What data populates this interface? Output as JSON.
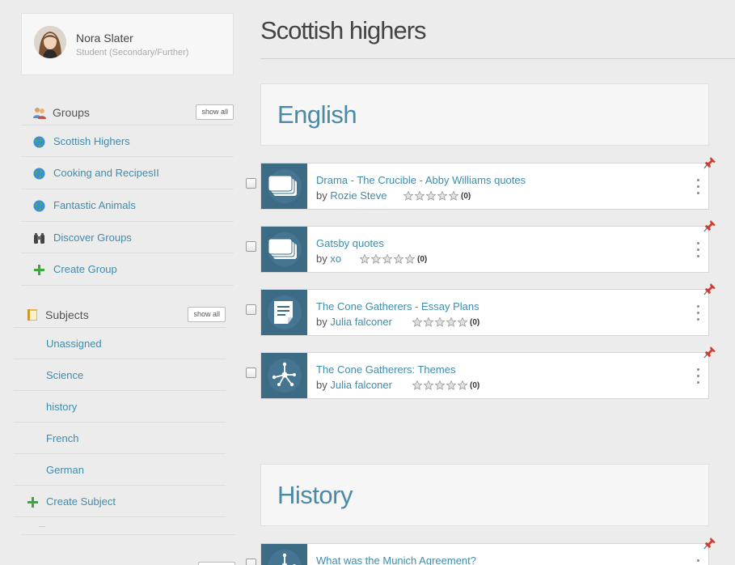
{
  "user": {
    "name": "Nora Slater",
    "role": "Student (Secondary/Further)"
  },
  "groups": {
    "title": "Groups",
    "show_all": "show all",
    "items": [
      {
        "label": "Scottish Highers",
        "icon": "globe-icon"
      },
      {
        "label": "Cooking and RecipesII",
        "icon": "globe-icon"
      },
      {
        "label": "Fantastic Animals",
        "icon": "globe-icon"
      },
      {
        "label": "Discover Groups",
        "icon": "binoculars-icon"
      },
      {
        "label": "Create Group",
        "icon": "plus-icon"
      }
    ]
  },
  "subjects": {
    "title": "Subjects",
    "show_all": "show all",
    "items": [
      "Unassigned",
      "Science",
      "history",
      "French",
      "German"
    ],
    "create_label": "Create Subject"
  },
  "page_title": "Scottish highers",
  "sections": [
    {
      "name": "English",
      "resources": [
        {
          "title": "Drama - The Crucible - Abby Williams quotes",
          "by": "by",
          "author": "Rozie Steve",
          "rating_count": "(0)",
          "type": "flashcards-icon"
        },
        {
          "title": "Gatsby quotes",
          "by": "by",
          "author": "xo",
          "rating_count": "(0)",
          "type": "flashcards-icon"
        },
        {
          "title": "The Cone Gatherers - Essay Plans",
          "by": "by",
          "author": "Julia falconer",
          "rating_count": "(0)",
          "type": "note-icon"
        },
        {
          "title": "The Cone Gatherers: Themes",
          "by": "by",
          "author": "Julia falconer",
          "rating_count": "(0)",
          "type": "mindmap-icon"
        }
      ]
    },
    {
      "name": "History",
      "resources": [
        {
          "title": "What was the Munich Agreement?",
          "type": "mindmap-icon"
        }
      ]
    }
  ],
  "colors": {
    "link": "#3f8cab",
    "thumb": "#3c6b86",
    "background": "#ececec"
  }
}
